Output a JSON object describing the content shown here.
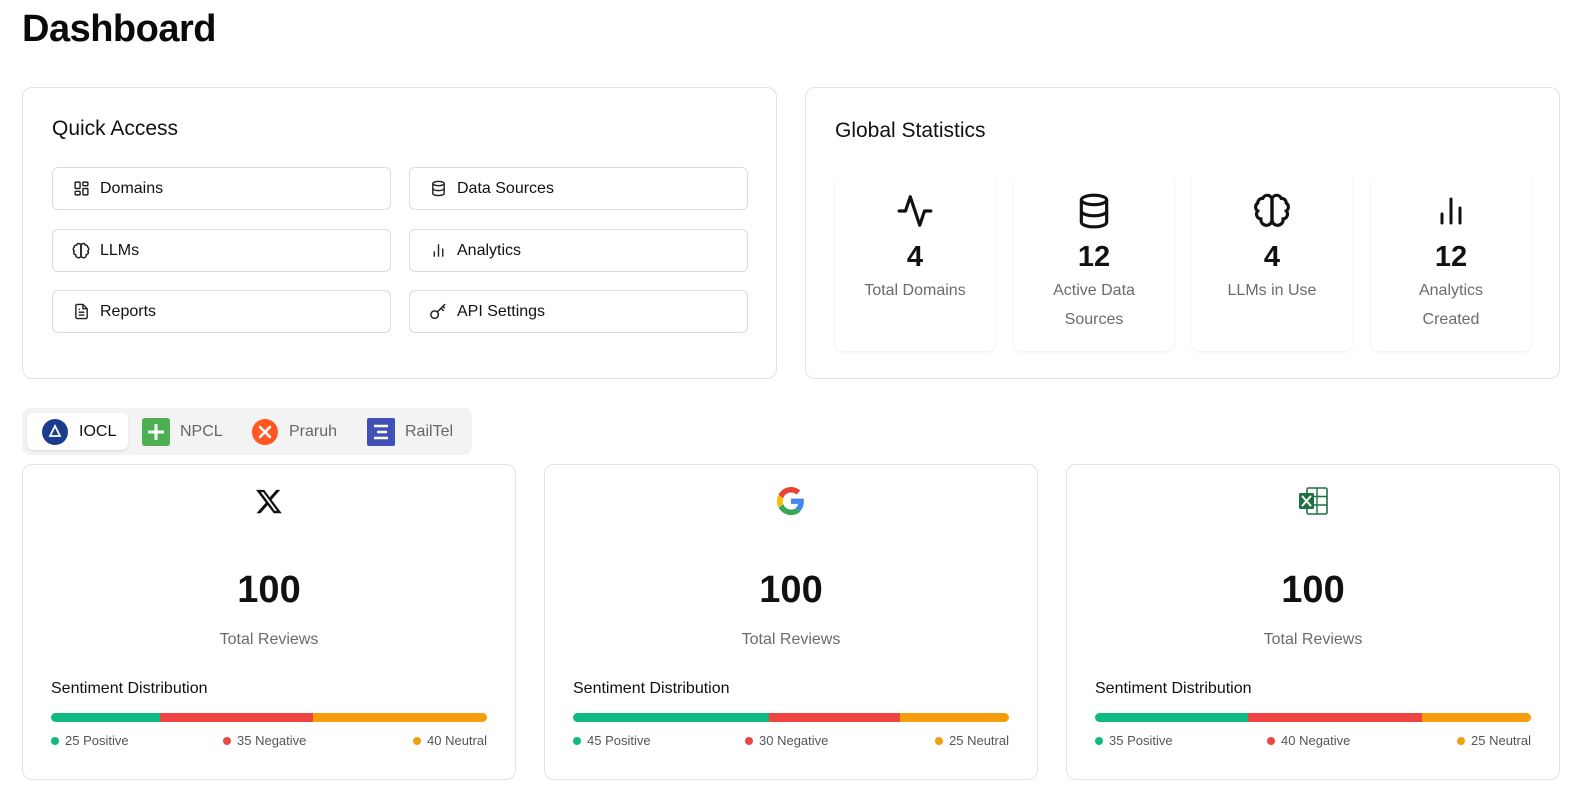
{
  "page": {
    "title": "Dashboard"
  },
  "quick_access": {
    "title": "Quick Access",
    "items": [
      {
        "label": "Domains",
        "icon": "grid-icon"
      },
      {
        "label": "Data Sources",
        "icon": "database-icon"
      },
      {
        "label": "LLMs",
        "icon": "brain-icon"
      },
      {
        "label": "Analytics",
        "icon": "bar-chart-icon"
      },
      {
        "label": "Reports",
        "icon": "document-icon"
      },
      {
        "label": "API Settings",
        "icon": "key-icon"
      }
    ]
  },
  "global_stats": {
    "title": "Global Statistics",
    "items": [
      {
        "value": "4",
        "label": "Total Domains",
        "icon": "activity-icon"
      },
      {
        "value": "12",
        "label": "Active Data Sources",
        "icon": "database-icon"
      },
      {
        "value": "4",
        "label": "LLMs in Use",
        "icon": "brain-icon"
      },
      {
        "value": "12",
        "label": "Analytics Created",
        "icon": "bar-chart-icon"
      }
    ]
  },
  "tabs": [
    {
      "label": "IOCL",
      "active": true,
      "logo": "iocl-logo",
      "color": "#1a3c8f"
    },
    {
      "label": "NPCL",
      "active": false,
      "logo": "npcl-logo",
      "color": "#4caf50"
    },
    {
      "label": "Praruh",
      "active": false,
      "logo": "praruh-logo",
      "color": "#ff5722"
    },
    {
      "label": "RailTel",
      "active": false,
      "logo": "railtel-logo",
      "color": "#3f51b5"
    }
  ],
  "sources": [
    {
      "icon": "x-twitter-icon",
      "total": "100",
      "total_label": "Total Reviews",
      "distribution_title": "Sentiment Distribution",
      "positive": 25,
      "negative": 35,
      "neutral": 40,
      "positive_label": "25 Positive",
      "negative_label": "35 Negative",
      "neutral_label": "40 Neutral"
    },
    {
      "icon": "google-icon",
      "total": "100",
      "total_label": "Total Reviews",
      "distribution_title": "Sentiment Distribution",
      "positive": 45,
      "negative": 30,
      "neutral": 25,
      "positive_label": "45 Positive",
      "negative_label": "30 Negative",
      "neutral_label": "25 Neutral"
    },
    {
      "icon": "excel-icon",
      "total": "100",
      "total_label": "Total Reviews",
      "distribution_title": "Sentiment Distribution",
      "positive": 35,
      "negative": 40,
      "neutral": 25,
      "positive_label": "35 Positive",
      "negative_label": "40 Negative",
      "neutral_label": "25 Neutral"
    }
  ],
  "colors": {
    "positive": "#10b981",
    "negative": "#ef4444",
    "neutral": "#f59e0b"
  }
}
